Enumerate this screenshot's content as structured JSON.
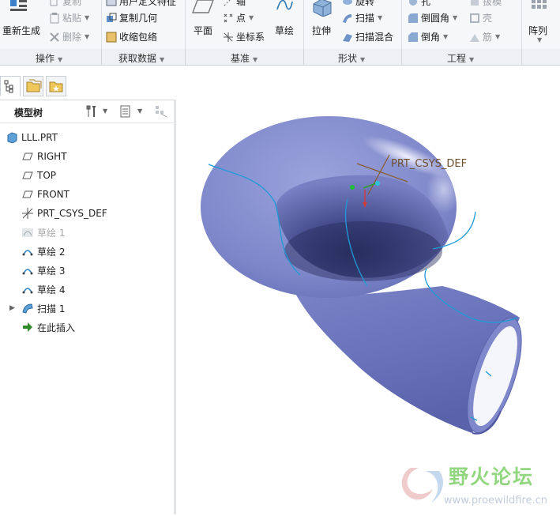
{
  "ribbon": {
    "groups": [
      {
        "label": "操作"
      },
      {
        "label": "获取数据"
      },
      {
        "label": "基准"
      },
      {
        "label": "形状"
      },
      {
        "label": "工程"
      }
    ],
    "operations": {
      "regenerate": "重新生成",
      "copy": "复制",
      "paste": "粘贴",
      "delete": "删除"
    },
    "get_data": {
      "user_defined_feature": "用户定义特征",
      "copy_geometry": "复制几何",
      "shrinkwrap": "收缩包络"
    },
    "datum": {
      "plane": "平面",
      "axis": "轴",
      "point": "点",
      "csys": "坐标系",
      "sketch": "草绘"
    },
    "shape": {
      "extrude": "拉伸",
      "revolve": "旋转",
      "sweep": "扫描",
      "swept_blend": "扫描混合"
    },
    "engineering": {
      "hole": "孔",
      "round": "倒圆角",
      "chamfer": "倒角",
      "draft": "拔模",
      "shell": "壳",
      "rib": "筋"
    },
    "pattern": "阵列"
  },
  "model_tree": {
    "title": "模型树",
    "items": [
      {
        "label": "LLL.PRT",
        "icon": "part-icon"
      },
      {
        "label": "RIGHT",
        "icon": "datum-plane-icon"
      },
      {
        "label": "TOP",
        "icon": "datum-plane-icon"
      },
      {
        "label": "FRONT",
        "icon": "datum-plane-icon"
      },
      {
        "label": "PRT_CSYS_DEF",
        "icon": "csys-icon"
      },
      {
        "label": "草绘 1",
        "icon": "sketch-icon",
        "suppressed": true
      },
      {
        "label": "草绘 2",
        "icon": "sketch-icon"
      },
      {
        "label": "草绘 3",
        "icon": "sketch-icon"
      },
      {
        "label": "草绘 4",
        "icon": "sketch-icon"
      },
      {
        "label": "扫描 1",
        "icon": "sweep-icon"
      },
      {
        "label": "在此插入",
        "icon": "insert-here-icon"
      }
    ]
  },
  "viewport": {
    "csys_label": "PRT_CSYS_DEF",
    "model_color": "#7d86c9"
  },
  "watermark": {
    "title": "野火论坛",
    "url": "www.proewildfire.cn"
  }
}
